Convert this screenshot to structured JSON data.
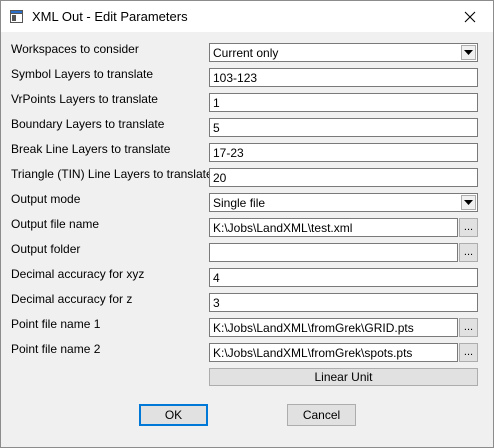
{
  "window": {
    "title": "XML Out - Edit Parameters"
  },
  "fields": {
    "workspaces": {
      "label": "Workspaces to consider",
      "value": "Current only"
    },
    "symbol_layers": {
      "label": "Symbol Layers to translate",
      "value": "103-123"
    },
    "vrpoints_layers": {
      "label": "VrPoints Layers to translate",
      "value": "1"
    },
    "boundary_layers": {
      "label": "Boundary Layers to translate",
      "value": "5"
    },
    "breakline_layers": {
      "label": "Break Line Layers to translate",
      "value": "17-23"
    },
    "triangle_layers": {
      "label": "Triangle (TIN) Line Layers to translate",
      "value": "20"
    },
    "output_mode": {
      "label": "Output mode",
      "value": "Single file"
    },
    "output_file_name": {
      "label": "Output file name",
      "value": "K:\\Jobs\\LandXML\\test.xml"
    },
    "output_folder": {
      "label": "Output folder",
      "value": ""
    },
    "decimal_xyz": {
      "label": "Decimal accuracy for xyz",
      "value": "4"
    },
    "decimal_z": {
      "label": "Decimal accuracy for z",
      "value": "3"
    },
    "point_file_1": {
      "label": "Point file name 1",
      "value": "K:\\Jobs\\LandXML\\fromGrek\\GRID.pts"
    },
    "point_file_2": {
      "label": "Point file name 2",
      "value": "K:\\Jobs\\LandXML\\fromGrek\\spots.pts"
    }
  },
  "buttons": {
    "browse": "...",
    "linear_unit": "Linear Unit",
    "ok": "OK",
    "cancel": "Cancel"
  },
  "icons": {
    "app": "window-icon",
    "close": "close-icon",
    "dropdown": "chevron-down-icon"
  }
}
